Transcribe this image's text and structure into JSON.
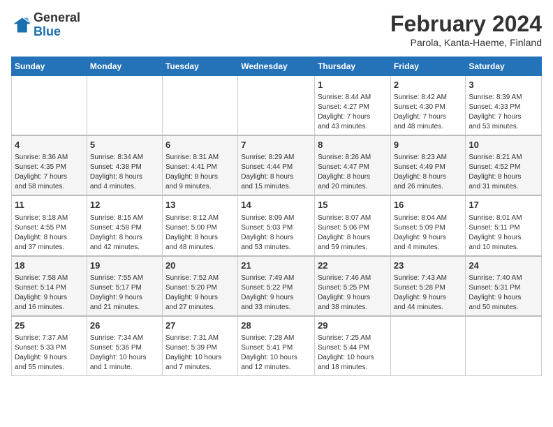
{
  "logo": {
    "text_general": "General",
    "text_blue": "Blue"
  },
  "header": {
    "title": "February 2024",
    "subtitle": "Parola, Kanta-Haeme, Finland"
  },
  "weekdays": [
    "Sunday",
    "Monday",
    "Tuesday",
    "Wednesday",
    "Thursday",
    "Friday",
    "Saturday"
  ],
  "weeks": [
    {
      "days": [
        {
          "num": "",
          "detail": ""
        },
        {
          "num": "",
          "detail": ""
        },
        {
          "num": "",
          "detail": ""
        },
        {
          "num": "",
          "detail": ""
        },
        {
          "num": "1",
          "detail": "Sunrise: 8:44 AM\nSunset: 4:27 PM\nDaylight: 7 hours\nand 43 minutes."
        },
        {
          "num": "2",
          "detail": "Sunrise: 8:42 AM\nSunset: 4:30 PM\nDaylight: 7 hours\nand 48 minutes."
        },
        {
          "num": "3",
          "detail": "Sunrise: 8:39 AM\nSunset: 4:33 PM\nDaylight: 7 hours\nand 53 minutes."
        }
      ]
    },
    {
      "days": [
        {
          "num": "4",
          "detail": "Sunrise: 8:36 AM\nSunset: 4:35 PM\nDaylight: 7 hours\nand 58 minutes."
        },
        {
          "num": "5",
          "detail": "Sunrise: 8:34 AM\nSunset: 4:38 PM\nDaylight: 8 hours\nand 4 minutes."
        },
        {
          "num": "6",
          "detail": "Sunrise: 8:31 AM\nSunset: 4:41 PM\nDaylight: 8 hours\nand 9 minutes."
        },
        {
          "num": "7",
          "detail": "Sunrise: 8:29 AM\nSunset: 4:44 PM\nDaylight: 8 hours\nand 15 minutes."
        },
        {
          "num": "8",
          "detail": "Sunrise: 8:26 AM\nSunset: 4:47 PM\nDaylight: 8 hours\nand 20 minutes."
        },
        {
          "num": "9",
          "detail": "Sunrise: 8:23 AM\nSunset: 4:49 PM\nDaylight: 8 hours\nand 26 minutes."
        },
        {
          "num": "10",
          "detail": "Sunrise: 8:21 AM\nSunset: 4:52 PM\nDaylight: 8 hours\nand 31 minutes."
        }
      ]
    },
    {
      "days": [
        {
          "num": "11",
          "detail": "Sunrise: 8:18 AM\nSunset: 4:55 PM\nDaylight: 8 hours\nand 37 minutes."
        },
        {
          "num": "12",
          "detail": "Sunrise: 8:15 AM\nSunset: 4:58 PM\nDaylight: 8 hours\nand 42 minutes."
        },
        {
          "num": "13",
          "detail": "Sunrise: 8:12 AM\nSunset: 5:00 PM\nDaylight: 8 hours\nand 48 minutes."
        },
        {
          "num": "14",
          "detail": "Sunrise: 8:09 AM\nSunset: 5:03 PM\nDaylight: 8 hours\nand 53 minutes."
        },
        {
          "num": "15",
          "detail": "Sunrise: 8:07 AM\nSunset: 5:06 PM\nDaylight: 8 hours\nand 59 minutes."
        },
        {
          "num": "16",
          "detail": "Sunrise: 8:04 AM\nSunset: 5:09 PM\nDaylight: 9 hours\nand 4 minutes."
        },
        {
          "num": "17",
          "detail": "Sunrise: 8:01 AM\nSunset: 5:11 PM\nDaylight: 9 hours\nand 10 minutes."
        }
      ]
    },
    {
      "days": [
        {
          "num": "18",
          "detail": "Sunrise: 7:58 AM\nSunset: 5:14 PM\nDaylight: 9 hours\nand 16 minutes."
        },
        {
          "num": "19",
          "detail": "Sunrise: 7:55 AM\nSunset: 5:17 PM\nDaylight: 9 hours\nand 21 minutes."
        },
        {
          "num": "20",
          "detail": "Sunrise: 7:52 AM\nSunset: 5:20 PM\nDaylight: 9 hours\nand 27 minutes."
        },
        {
          "num": "21",
          "detail": "Sunrise: 7:49 AM\nSunset: 5:22 PM\nDaylight: 9 hours\nand 33 minutes."
        },
        {
          "num": "22",
          "detail": "Sunrise: 7:46 AM\nSunset: 5:25 PM\nDaylight: 9 hours\nand 38 minutes."
        },
        {
          "num": "23",
          "detail": "Sunrise: 7:43 AM\nSunset: 5:28 PM\nDaylight: 9 hours\nand 44 minutes."
        },
        {
          "num": "24",
          "detail": "Sunrise: 7:40 AM\nSunset: 5:31 PM\nDaylight: 9 hours\nand 50 minutes."
        }
      ]
    },
    {
      "days": [
        {
          "num": "25",
          "detail": "Sunrise: 7:37 AM\nSunset: 5:33 PM\nDaylight: 9 hours\nand 55 minutes."
        },
        {
          "num": "26",
          "detail": "Sunrise: 7:34 AM\nSunset: 5:36 PM\nDaylight: 10 hours\nand 1 minute."
        },
        {
          "num": "27",
          "detail": "Sunrise: 7:31 AM\nSunset: 5:39 PM\nDaylight: 10 hours\nand 7 minutes."
        },
        {
          "num": "28",
          "detail": "Sunrise: 7:28 AM\nSunset: 5:41 PM\nDaylight: 10 hours\nand 12 minutes."
        },
        {
          "num": "29",
          "detail": "Sunrise: 7:25 AM\nSunset: 5:44 PM\nDaylight: 10 hours\nand 18 minutes."
        },
        {
          "num": "",
          "detail": ""
        },
        {
          "num": "",
          "detail": ""
        }
      ]
    }
  ]
}
